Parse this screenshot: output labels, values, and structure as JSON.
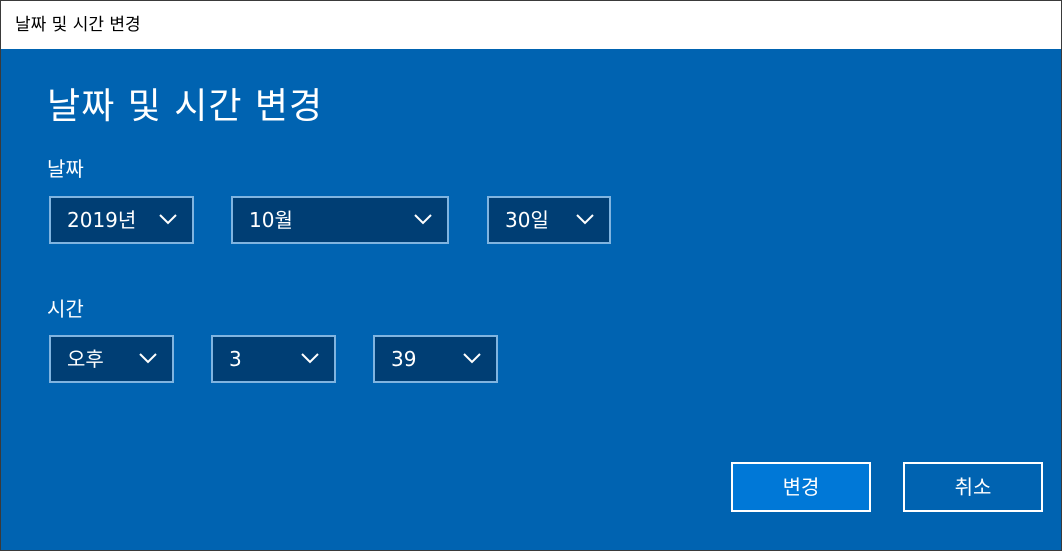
{
  "window": {
    "title": "날짜 및 시간 변경"
  },
  "dialog": {
    "heading": "날짜 및 시간 변경",
    "date": {
      "label": "날짜",
      "year": "2019년",
      "month": "10월",
      "day": "30일"
    },
    "time": {
      "label": "시간",
      "ampm": "오후",
      "hour": "3",
      "minute": "39"
    },
    "buttons": {
      "change": "변경",
      "cancel": "취소"
    }
  },
  "colors": {
    "background": "#0063b1",
    "combo_fill": "#003e74",
    "combo_border": "#80b4e0",
    "primary_button": "#0078d7"
  },
  "icons": {
    "dropdown": "chevron-down-icon"
  }
}
